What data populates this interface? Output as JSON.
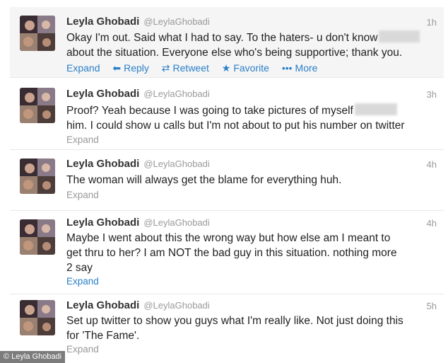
{
  "tweets": [
    {
      "name": "Leyla Ghobadi",
      "handle": "@LeylaGhobadi",
      "time": "1h",
      "lines": [
        "Okay I'm out. Said what I had to say. To the haters- u don't know",
        "about the situation. Everyone else who's being supportive; thank you."
      ],
      "actions": {
        "expand": "Expand",
        "reply": "Reply",
        "retweet": "Retweet",
        "favorite": "Favorite",
        "more": "More"
      }
    },
    {
      "name": "Leyla Ghobadi",
      "handle": "@LeylaGhobadi",
      "time": "3h",
      "lines": [
        "Proof? Yeah because I was going to take pictures of myself",
        "him. I could show u calls but I'm not about to put his number on twitter"
      ],
      "expand": "Expand"
    },
    {
      "name": "Leyla Ghobadi",
      "handle": "@LeylaGhobadi",
      "time": "4h",
      "lines": [
        "The woman will always get the blame for everything huh."
      ],
      "expand": "Expand"
    },
    {
      "name": "Leyla Ghobadi",
      "handle": "@LeylaGhobadi",
      "time": "4h",
      "lines": [
        "Maybe I went about this the wrong way but how else am I meant to",
        "get thru to her? I am NOT the bad guy in this situation. nothing more",
        "2 say"
      ],
      "expand": "Expand"
    },
    {
      "name": "Leyla Ghobadi",
      "handle": "@LeylaGhobadi",
      "time": "5h",
      "lines": [
        "Set up twitter to show you guys what I'm really like. Not just doing this",
        "for 'The Fame'."
      ],
      "expand": "Expand"
    }
  ],
  "credit": "© Leyla Ghobadi",
  "colors": {
    "link": "#2a7fc8",
    "muted": "#999999",
    "hover_bg": "#f5f5f5"
  }
}
